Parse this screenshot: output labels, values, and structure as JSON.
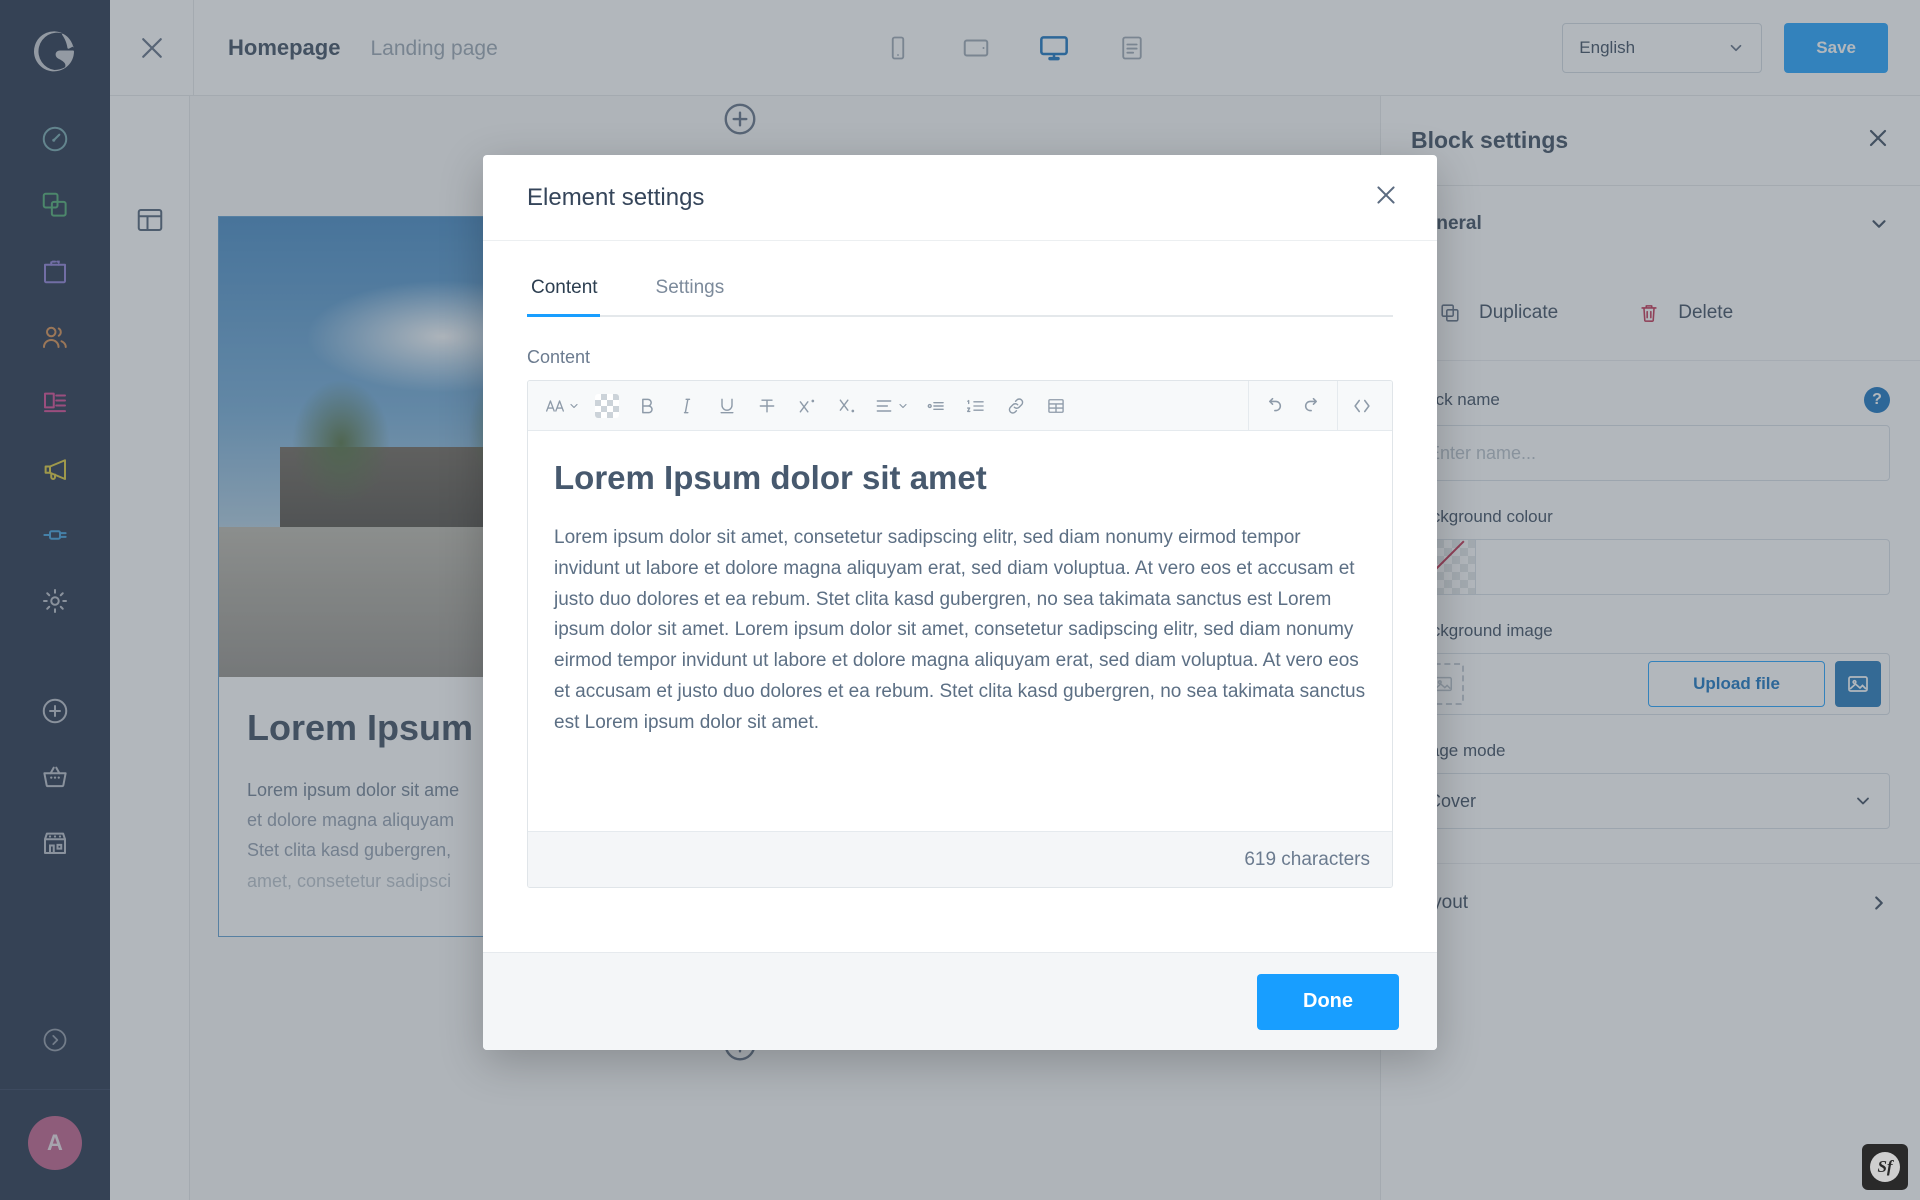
{
  "sidebar": {
    "logo_name": "shopware-logo",
    "items": [
      {
        "name": "dashboard",
        "icon": "dashboard-icon",
        "color": "#70a4ab"
      },
      {
        "name": "catalogues",
        "icon": "catalogue-icon",
        "color": "#46a86c"
      },
      {
        "name": "orders",
        "icon": "orders-bag-icon",
        "color": "#8a7ad6"
      },
      {
        "name": "customers",
        "icon": "customers-icon",
        "color": "#d68a4a"
      },
      {
        "name": "content",
        "icon": "content-icon",
        "color": "#d6408f"
      },
      {
        "name": "marketing",
        "icon": "megaphone-icon",
        "color": "#ddc832"
      },
      {
        "name": "extensions",
        "icon": "plug-icon",
        "color": "#3a9ddd"
      },
      {
        "name": "settings",
        "icon": "gear-icon",
        "color": "#b6bcc6"
      }
    ],
    "quick_items": [
      {
        "name": "add",
        "icon": "plus-circle-icon",
        "color": "#b6bcc6"
      },
      {
        "name": "basket",
        "icon": "basket-icon",
        "color": "#b6bcc6"
      },
      {
        "name": "storefront",
        "icon": "storefront-icon",
        "color": "#b6bcc6"
      }
    ],
    "expand": {
      "name": "expand",
      "icon": "chevron-right-circle-icon",
      "color": "#8d96a4"
    },
    "avatar_initial": "A"
  },
  "topbar": {
    "close_icon": "close-icon",
    "title": "Homepage",
    "subtitle": "Landing page",
    "devices": [
      {
        "name": "mobile",
        "icon": "mobile-icon",
        "active": false
      },
      {
        "name": "tablet",
        "icon": "tablet-icon",
        "active": false
      },
      {
        "name": "desktop",
        "icon": "desktop-icon",
        "active": true
      },
      {
        "name": "form",
        "icon": "form-icon",
        "active": false
      }
    ],
    "language_value": "English",
    "save_label": "Save",
    "accent": "#189eff"
  },
  "canvas": {
    "rail_icon": "layout-sidebar-icon",
    "add_block_icon": "plus-circle-icon",
    "gear_icon": "gear-icon",
    "block": {
      "heading": "Lorem Ipsum d",
      "paragraph_line1": "Lorem ipsum dolor sit ame",
      "paragraph_line2": "et dolore magna aliquyam",
      "paragraph_line3": "Stet clita kasd gubergren,",
      "paragraph_line4": "amet, consetetur sadipsci"
    }
  },
  "right_panel": {
    "title": "Block settings",
    "close_icon": "close-icon",
    "section_title": "General",
    "section_chevron": "chevron-down-icon",
    "duplicate_label": "Duplicate",
    "duplicate_icon": "duplicate-icon",
    "delete_label": "Delete",
    "delete_icon": "trash-icon",
    "delete_color": "#c0274a",
    "block_name_label": "Block name",
    "block_name_placeholder": "Enter name...",
    "block_name_value": "",
    "help_icon": "help-icon",
    "background_colour_label": "Background colour",
    "background_colour_value": "",
    "background_image_label": "Background image",
    "upload_label": "Upload file",
    "upload_icon": "image-icon",
    "image_placeholder_icon": "image-placeholder-icon",
    "image_mode_label": "Image mode",
    "image_mode_value": "Cover",
    "layout_label": "Layout",
    "layout_chevron": "chevron-right-icon"
  },
  "modal": {
    "title": "Element settings",
    "close_icon": "close-icon",
    "tabs": [
      {
        "label": "Content",
        "active": true
      },
      {
        "label": "Settings",
        "active": false
      }
    ],
    "content_label": "Content",
    "toolbar": [
      {
        "name": "font-size",
        "icon": "font-size-icon",
        "chevron": true
      },
      {
        "name": "text-colour",
        "icon": "colour-picker-icon",
        "boxed": true
      },
      {
        "name": "bold",
        "icon": "bold-icon"
      },
      {
        "name": "italic",
        "icon": "italic-icon"
      },
      {
        "name": "underline",
        "icon": "underline-icon"
      },
      {
        "name": "strikethrough",
        "icon": "strikethrough-icon"
      },
      {
        "name": "superscript",
        "icon": "superscript-icon"
      },
      {
        "name": "subscript",
        "icon": "subscript-icon"
      },
      {
        "name": "align",
        "icon": "align-icon",
        "chevron": true
      },
      {
        "name": "bullet-list",
        "icon": "bullet-list-icon"
      },
      {
        "name": "ordered-list",
        "icon": "ordered-list-icon"
      },
      {
        "name": "link",
        "icon": "link-icon"
      },
      {
        "name": "table",
        "icon": "table-icon"
      }
    ],
    "toolbar_right": [
      {
        "name": "undo",
        "icon": "undo-icon"
      },
      {
        "name": "redo",
        "icon": "redo-icon"
      },
      {
        "name": "source-code",
        "icon": "code-icon"
      }
    ],
    "doc_heading": "Lorem Ipsum dolor sit amet",
    "doc_paragraph": "Lorem ipsum dolor sit amet, consetetur sadipscing elitr, sed diam nonumy eirmod tempor invidunt ut labore et dolore magna aliquyam erat, sed diam voluptua. At vero eos et accusam et justo duo dolores et ea rebum. Stet clita kasd gubergren, no sea takimata sanctus est Lorem ipsum dolor sit amet. Lorem ipsum dolor sit amet, consetetur sadipscing elitr, sed diam nonumy eirmod tempor invidunt ut labore et dolore magna aliquyam erat, sed diam voluptua. At vero eos et accusam et justo duo dolores et ea rebum. Stet clita kasd gubergren, no sea takimata sanctus est Lorem ipsum dolor sit amet.",
    "character_count": "619 characters",
    "done_label": "Done"
  },
  "debug": {
    "badge_label": "Sf",
    "badge_name": "symfony-toolbar"
  }
}
